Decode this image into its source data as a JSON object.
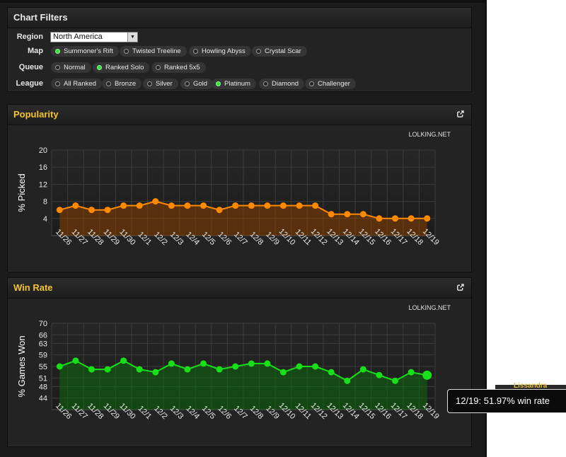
{
  "filters": {
    "title": "Chart Filters",
    "region_label": "Region",
    "region_value": "North America",
    "map_label": "Map",
    "map_options": [
      {
        "label": "Summoner's Rift",
        "selected": true
      },
      {
        "label": "Twisted Treeline",
        "selected": false
      },
      {
        "label": "Howling Abyss",
        "selected": false
      },
      {
        "label": "Crystal Scar",
        "selected": false
      }
    ],
    "queue_label": "Queue",
    "queue_options": [
      {
        "label": "Normal",
        "selected": false
      },
      {
        "label": "Ranked Solo",
        "selected": true
      },
      {
        "label": "Ranked 5x5",
        "selected": false
      }
    ],
    "league_label": "League",
    "league_options": [
      {
        "label": "All Ranked",
        "selected": false
      },
      {
        "label": "Bronze",
        "selected": false
      },
      {
        "label": "Silver",
        "selected": false
      },
      {
        "label": "Gold",
        "selected": false
      },
      {
        "label": "Platinum",
        "selected": true
      },
      {
        "label": "Diamond",
        "selected": false
      },
      {
        "label": "Challenger",
        "selected": false
      }
    ]
  },
  "popularity": {
    "title": "Popularity",
    "watermark": "LOLKING.NET"
  },
  "winrate": {
    "title": "Win Rate",
    "watermark": "LOLKING.NET"
  },
  "tooltip": {
    "text": "12/19: 51.97% win rate"
  },
  "peek": {
    "text": "Lissandra"
  },
  "colors": {
    "orange": "#ff8a00",
    "green": "#18e018",
    "gold": "#f5c431"
  },
  "chart_data": [
    {
      "type": "area",
      "title": "Popularity",
      "ylabel": "% Picked",
      "ylim": [
        0,
        20
      ],
      "yticks": [
        4,
        8,
        12,
        16,
        20
      ],
      "grid": true,
      "categories": [
        "11/26",
        "11/27",
        "11/28",
        "11/29",
        "11/30",
        "12/1",
        "12/2",
        "12/3",
        "12/4",
        "12/5",
        "12/6",
        "12/7",
        "12/8",
        "12/9",
        "12/10",
        "12/11",
        "12/12",
        "12/13",
        "12/14",
        "12/15",
        "12/16",
        "12/17",
        "12/18",
        "12/19"
      ],
      "series": [
        {
          "values": [
            6,
            7,
            6,
            6,
            7,
            7,
            8,
            7,
            7,
            7,
            6,
            7,
            7,
            7,
            7,
            7,
            7,
            5,
            5,
            5,
            4,
            4,
            4,
            4
          ]
        }
      ]
    },
    {
      "type": "area",
      "title": "Win Rate",
      "ylabel": "% Games Won",
      "ylim": [
        40,
        70
      ],
      "yticks": [
        44,
        48,
        51,
        55,
        59,
        63,
        66,
        70
      ],
      "grid": true,
      "categories": [
        "11/26",
        "11/27",
        "11/28",
        "11/29",
        "11/30",
        "12/1",
        "12/2",
        "12/3",
        "12/4",
        "12/5",
        "12/6",
        "12/7",
        "12/8",
        "12/9",
        "12/10",
        "12/11",
        "12/12",
        "12/13",
        "12/14",
        "12/15",
        "12/16",
        "12/17",
        "12/18",
        "12/19"
      ],
      "series": [
        {
          "values": [
            55,
            57,
            54,
            54,
            57,
            54,
            53,
            56,
            54,
            56,
            54,
            55,
            56,
            56,
            53,
            55,
            55,
            53,
            50,
            54,
            52,
            50,
            53,
            51.97
          ]
        }
      ]
    }
  ]
}
